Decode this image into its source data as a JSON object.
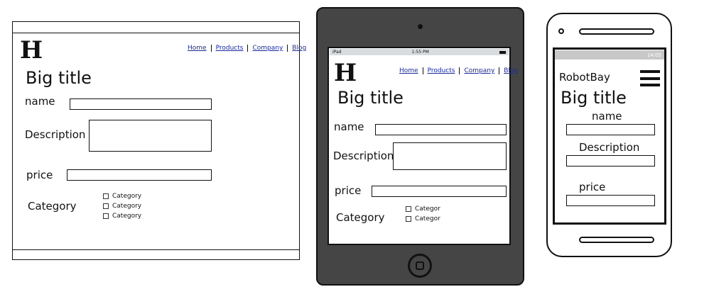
{
  "nav": [
    "Home",
    "Products",
    "Company",
    "Blog"
  ],
  "logo": "H",
  "title": "Big title",
  "fields": {
    "name": "name",
    "description": "Description",
    "price": "price",
    "category": "Category"
  },
  "desktop": {
    "checkboxes": [
      "Category",
      "Category",
      "Category"
    ]
  },
  "tablet": {
    "status": {
      "device": "iPad",
      "time": "1:55 PM"
    },
    "checkboxes": [
      "Categor",
      "Categor"
    ]
  },
  "phone": {
    "brand": "RobotBay",
    "status": {
      "time": "14:05"
    }
  }
}
